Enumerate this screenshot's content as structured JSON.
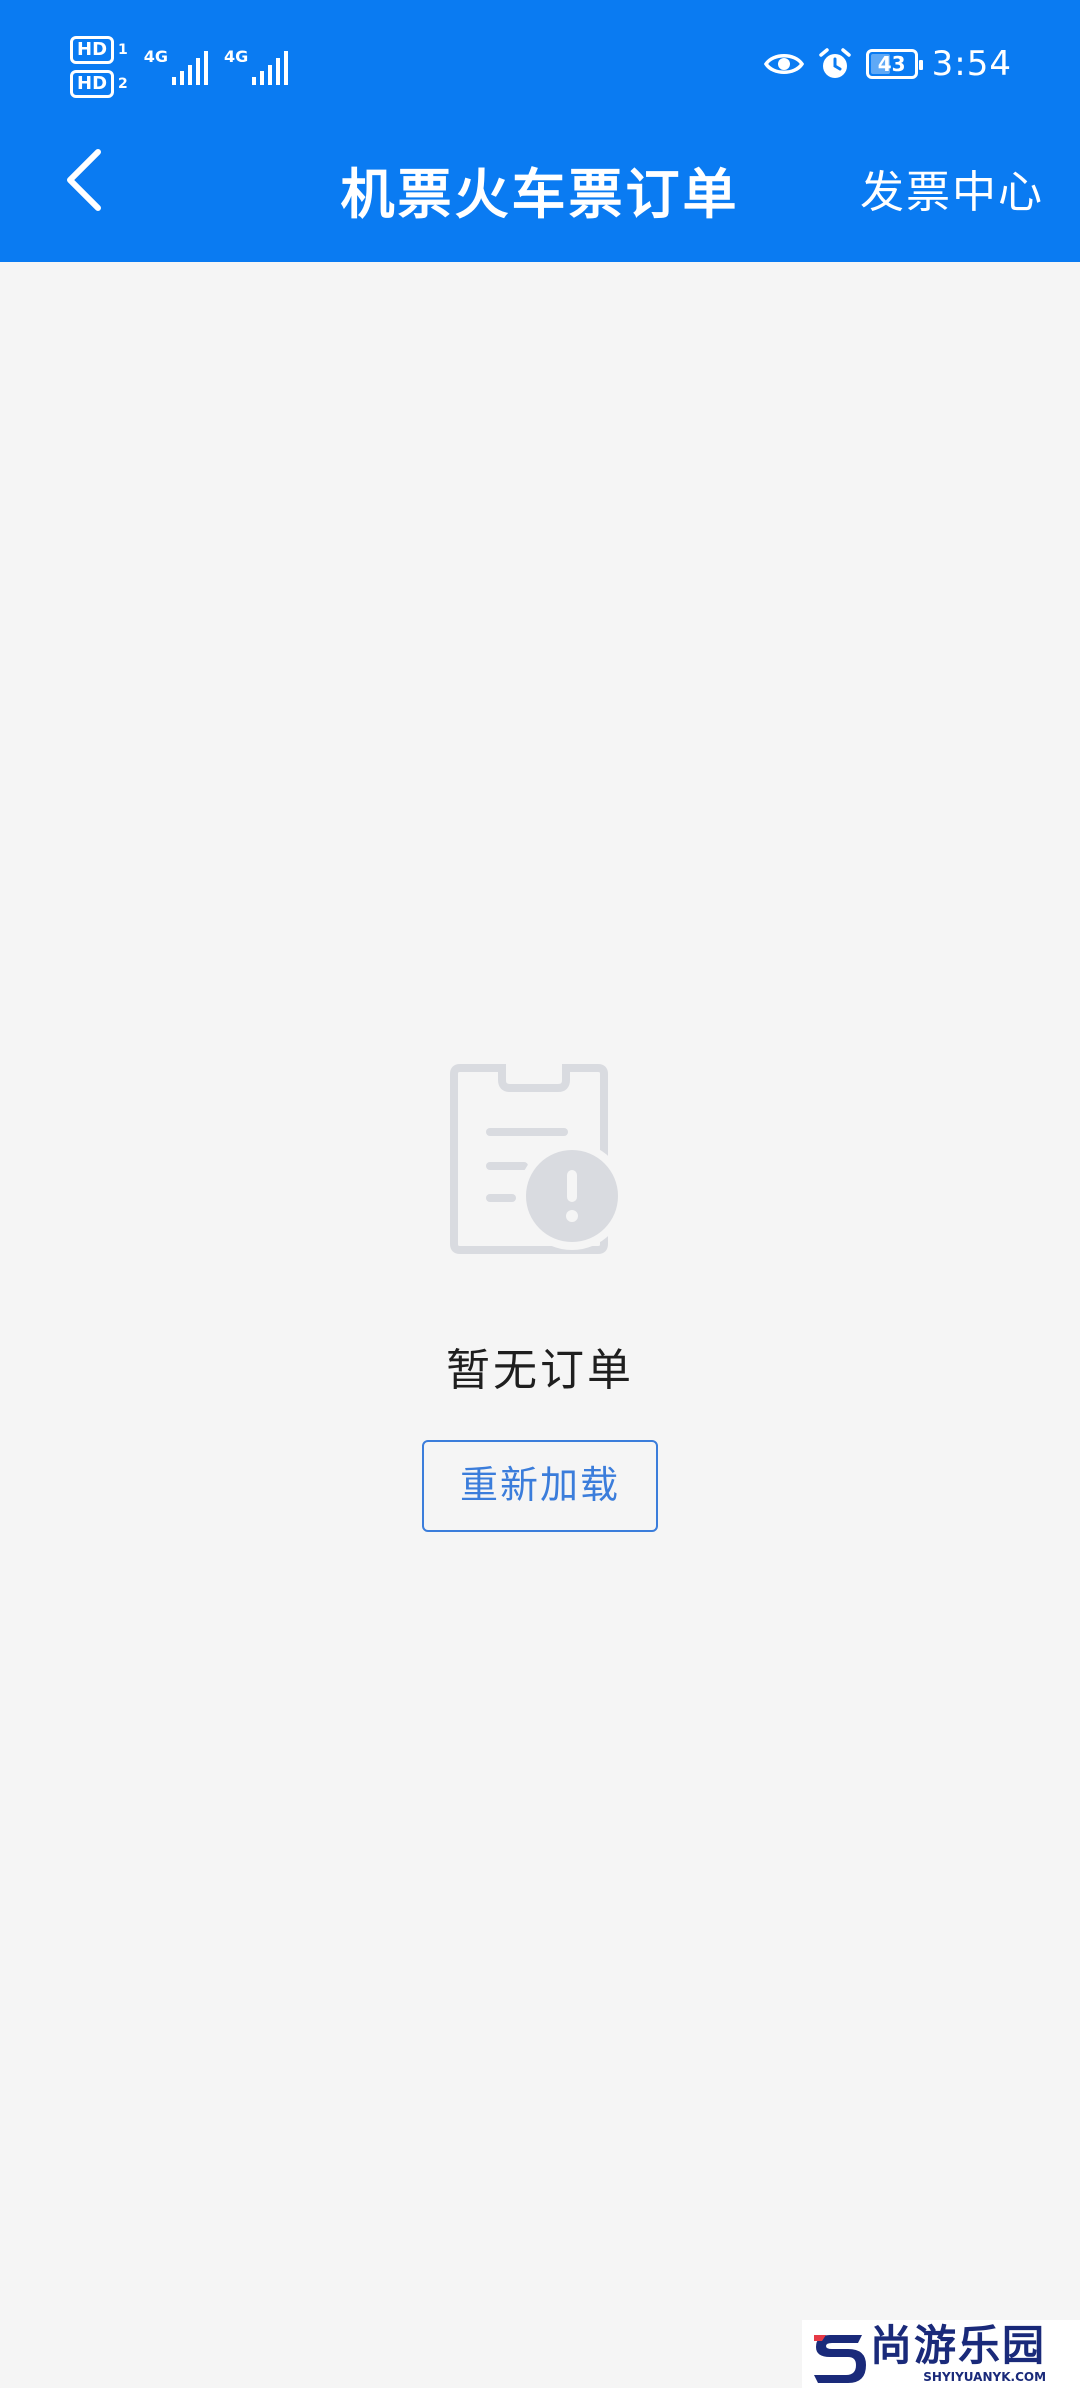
{
  "status_bar": {
    "sim1_label": "HD",
    "sim1_index": "1",
    "sim2_label": "HD",
    "sim2_index": "2",
    "network1": "4G",
    "network2": "4G",
    "battery_level": "43",
    "time": "3:54"
  },
  "nav": {
    "title": "机票火车票订单",
    "right_link": "发票中心",
    "back_icon": "chevron-left-icon"
  },
  "empty_state": {
    "message": "暂无订单",
    "reload_label": "重新加载",
    "icon": "clipboard-warning-icon"
  },
  "watermark": {
    "name": "尚游乐园",
    "url": "SHYIYUANYK.COM"
  },
  "colors": {
    "header_bg": "#0a7bf2",
    "page_bg": "#f5f5f5",
    "button_accent": "#3b7ddb",
    "icon_gray": "#d9dbe0"
  }
}
